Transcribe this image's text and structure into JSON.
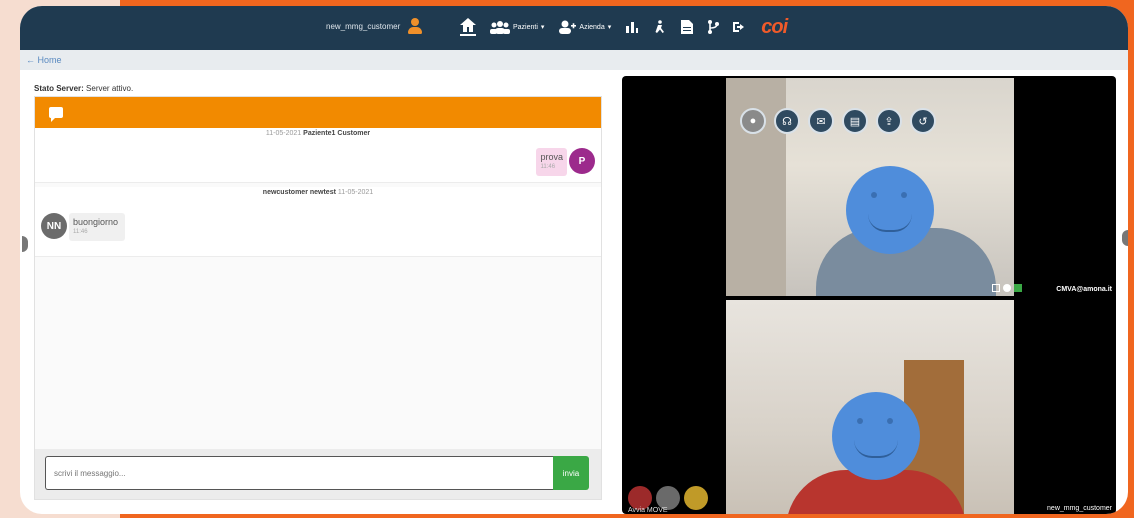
{
  "topnav": {
    "username": "new_mmg_customer",
    "items": [
      {
        "label": "",
        "icon": "home-icon"
      },
      {
        "label": "Pazienti",
        "icon": "users-icon"
      },
      {
        "label": "Azienda",
        "icon": "user-plus-icon"
      },
      {
        "label": "",
        "icon": "chart-icon"
      },
      {
        "label": "",
        "icon": "accessibility-icon"
      },
      {
        "label": "",
        "icon": "document-icon"
      },
      {
        "label": "",
        "icon": "branch-icon"
      },
      {
        "label": "",
        "icon": "logout-icon"
      }
    ],
    "logo": "coi"
  },
  "breadcrumb": {
    "home": "Home"
  },
  "status": {
    "label": "Stato Server:",
    "value": "Server attivo."
  },
  "chat": {
    "messages": [
      {
        "meta_date": "11-05-2021",
        "meta_author": "Paziente1 Customer",
        "text": "prova",
        "time": "11:46",
        "avatar": "P"
      },
      {
        "meta_author": "newcustomer newtest",
        "meta_date": "11-05-2021",
        "text": "buongiorno",
        "time": "11:46",
        "avatar": "NN"
      }
    ],
    "composer": {
      "placeholder": "scrivi il messaggio...",
      "send_label": "invia"
    }
  },
  "video": {
    "remote_label": "CMVA@amona.it",
    "local_label": "new_mmg_customer",
    "bottom_label": "Avvia MOVE",
    "controls": [
      "record-icon",
      "headset-icon",
      "messenger-icon",
      "file-icon",
      "file-upload-icon",
      "refresh-icon"
    ]
  }
}
